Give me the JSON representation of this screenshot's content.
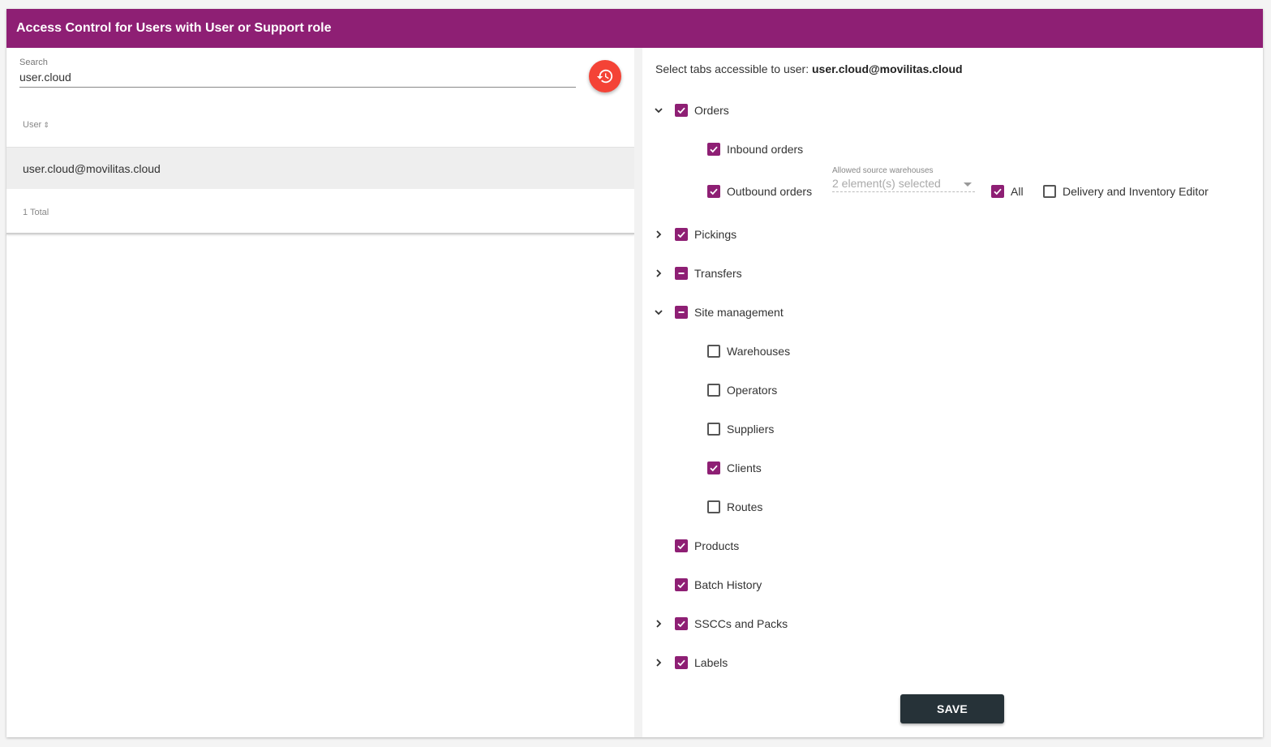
{
  "header": {
    "title": "Access Control for Users with User or Support role"
  },
  "left": {
    "search": {
      "label": "Search",
      "value": "user.cloud"
    },
    "table": {
      "column_header": "User",
      "sort_indicator": "⇕",
      "rows": [
        "user.cloud@movilitas.cloud"
      ],
      "total": "1 Total"
    }
  },
  "right": {
    "heading_prefix": "Select tabs accessible to user:",
    "heading_user": "user.cloud@movilitas.cloud",
    "tree": {
      "orders": {
        "label": "Orders",
        "state": "checked",
        "expanded": true
      },
      "inbound_orders": {
        "label": "Inbound orders",
        "state": "checked"
      },
      "outbound_orders": {
        "label": "Outbound orders",
        "state": "checked"
      },
      "warehouses_select": {
        "label": "Allowed source warehouses",
        "value": "2 element(s) selected"
      },
      "all": {
        "label": "All",
        "state": "checked"
      },
      "delivery_editor": {
        "label": "Delivery and Inventory Editor",
        "state": "unchecked"
      },
      "pickings": {
        "label": "Pickings",
        "state": "checked",
        "expanded": false
      },
      "transfers": {
        "label": "Transfers",
        "state": "indeterminate",
        "expanded": false
      },
      "site_management": {
        "label": "Site management",
        "state": "indeterminate",
        "expanded": true
      },
      "warehouses": {
        "label": "Warehouses",
        "state": "unchecked"
      },
      "operators": {
        "label": "Operators",
        "state": "unchecked"
      },
      "suppliers": {
        "label": "Suppliers",
        "state": "unchecked"
      },
      "clients": {
        "label": "Clients",
        "state": "checked"
      },
      "routes": {
        "label": "Routes",
        "state": "unchecked"
      },
      "products": {
        "label": "Products",
        "state": "checked"
      },
      "batch_history": {
        "label": "Batch History",
        "state": "checked"
      },
      "sscc_packs": {
        "label": "SSCCs and Packs",
        "state": "checked",
        "expanded": false
      },
      "labels": {
        "label": "Labels",
        "state": "checked",
        "expanded": false
      }
    },
    "save_label": "SAVE"
  },
  "colors": {
    "brand": "#8e1f74",
    "history_button": "#f44336",
    "save_button": "#263238"
  }
}
